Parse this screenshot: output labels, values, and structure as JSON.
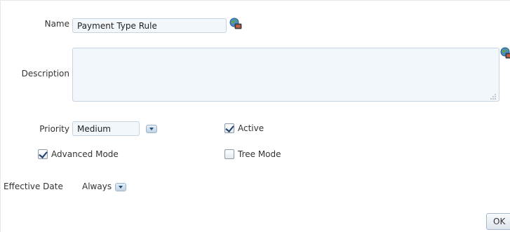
{
  "form": {
    "name_label": "Name",
    "name_value": "Payment Type Rule",
    "description_label": "Description",
    "description_value": "",
    "priority_label": "Priority",
    "priority_value": "Medium",
    "active_label": "Active",
    "active_checked": true,
    "advanced_mode_label": "Advanced Mode",
    "advanced_mode_checked": true,
    "tree_mode_label": "Tree Mode",
    "tree_mode_checked": false,
    "effective_date_label": "Effective Date",
    "effective_date_value": "Always"
  },
  "buttons": {
    "ok_label": "OK"
  },
  "icons": {
    "translate": "translate-globe-icon",
    "dropdown": "chevron-down-icon",
    "resize": "resize-grip-icon"
  }
}
